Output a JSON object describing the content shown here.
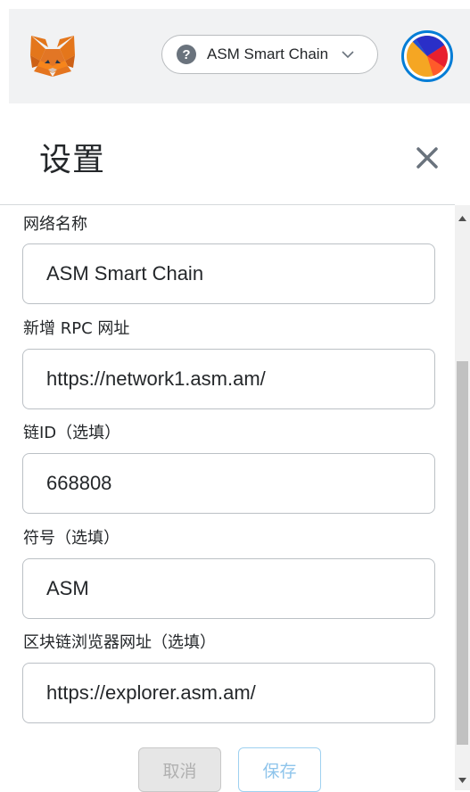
{
  "header": {
    "network_name": "ASM Smart Chain",
    "help_icon": "question-circle-icon",
    "avatar_icon": "account-identicon"
  },
  "page": {
    "title": "设置",
    "close_icon": "close-icon"
  },
  "form": {
    "fields": [
      {
        "label": "网络名称",
        "value": "ASM Smart Chain"
      },
      {
        "label": "新增 RPC 网址",
        "value": "https://network1.asm.am/"
      },
      {
        "label": "链ID（选填）",
        "value": "668808"
      },
      {
        "label": "符号（选填）",
        "value": "ASM"
      },
      {
        "label": "区块链浏览器网址（选填）",
        "value": "https://explorer.asm.am/"
      }
    ],
    "cancel_label": "取消",
    "save_label": "保存"
  },
  "colors": {
    "accent": "#037dd6",
    "header_bg": "#f1f2f3",
    "fox_orange": "#e2761b"
  }
}
